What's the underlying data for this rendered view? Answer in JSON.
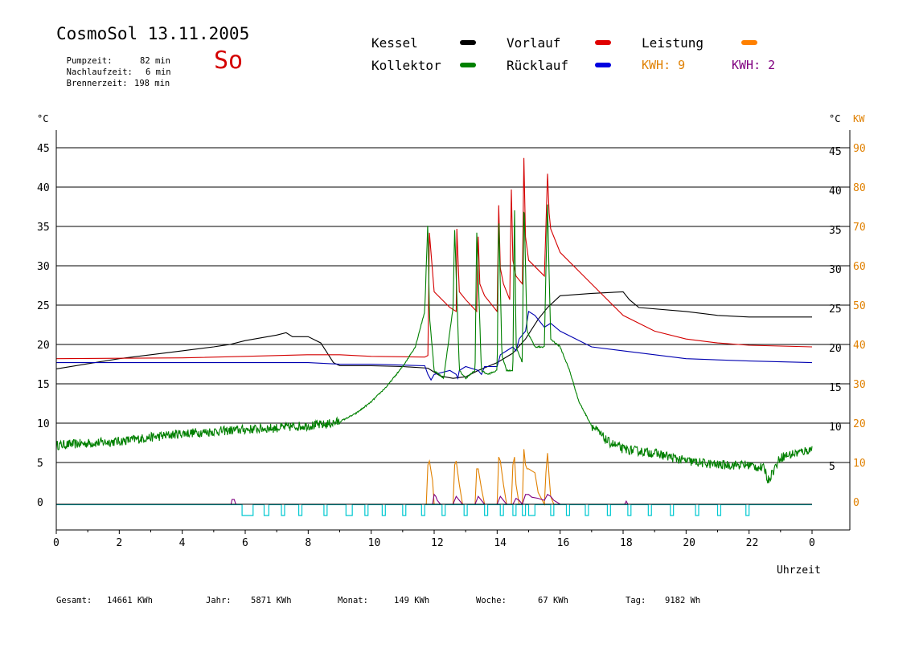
{
  "header": {
    "title": "CosmoSol 13.11.2005",
    "day": "So",
    "stats": [
      {
        "label": "Pumpzeit:",
        "value": "82 min"
      },
      {
        "label": "Nachlaufzeit:",
        "value": "6 min"
      },
      {
        "label": "Brennerzeit:",
        "value": "198 min"
      }
    ]
  },
  "legend": {
    "items": [
      {
        "label": "Kessel",
        "color": "#000000"
      },
      {
        "label": "Vorlauf",
        "color": "#e00000"
      },
      {
        "label": "Leistung",
        "color": "#ff8000"
      },
      {
        "label": "Kollektor",
        "color": "#008000"
      },
      {
        "label": "Rücklauf",
        "color": "#0000e0"
      }
    ],
    "kwh_orange": "KWH: 9",
    "kwh_purple": "KWH: 2"
  },
  "colors": {
    "kessel": "#000000",
    "vorlauf": "#d40000",
    "ruecklauf": "#0000b0",
    "kollektor": "#008000",
    "leistung": "#e08000",
    "purple": "#800080",
    "pump": "#00c8d0"
  },
  "footer": {
    "items": [
      {
        "label": "Gesamt:",
        "value": "14661 KWh"
      },
      {
        "label": "Jahr:",
        "value": "5871 KWh"
      },
      {
        "label": "Monat:",
        "value": "149 KWh"
      },
      {
        "label": "Woche:",
        "value": "67 KWh"
      },
      {
        "label": "Tag:",
        "value": "9182 Wh"
      }
    ]
  },
  "chart_data": {
    "type": "line",
    "xlabel": "Uhrzeit",
    "ylabel_left": "°C",
    "ylabel_right_c": "°C",
    "ylabel_right_kw": "KW",
    "xlim": [
      0,
      24
    ],
    "ylim": [
      0,
      45
    ],
    "kw_lim": [
      0,
      90
    ],
    "x_ticks": [
      0,
      2,
      4,
      6,
      8,
      10,
      12,
      14,
      16,
      18,
      20,
      22,
      24
    ],
    "x_tick_labels": [
      "0",
      "2",
      "4",
      "6",
      "8",
      "10",
      "12",
      "14",
      "16",
      "18",
      "20",
      "22",
      "0"
    ],
    "y_ticks": [
      0,
      5,
      10,
      15,
      20,
      25,
      30,
      35,
      40,
      45
    ],
    "y_tick_labels": [
      "0",
      "5",
      "10",
      "15",
      "20",
      "25",
      "30",
      "35",
      "40",
      "45"
    ],
    "kw_ticks": [
      0,
      10,
      20,
      30,
      40,
      50,
      60,
      70,
      80,
      90
    ],
    "kw_tick_labels": [
      "0",
      "10",
      "20",
      "30",
      "40",
      "50",
      "60",
      "70",
      "80",
      "90"
    ],
    "grid": "horizontal",
    "series": [
      {
        "name": "Kessel",
        "color": "#000000",
        "noise": 0,
        "x": [
          0,
          2,
          4,
          5,
          5.5,
          6,
          7,
          7.3,
          7.5,
          8,
          8.4,
          8.8,
          9,
          10,
          11,
          11.8,
          12.2,
          12.6,
          13,
          13.4,
          14,
          14.5,
          14.9,
          15.3,
          15.6,
          16,
          17,
          18,
          18.2,
          18.5,
          20,
          21,
          22,
          24
        ],
        "y": [
          17.2,
          18.5,
          19.5,
          20,
          20.3,
          20.8,
          21.5,
          21.8,
          21.3,
          21.3,
          20.5,
          18,
          17.6,
          17.6,
          17.5,
          17.3,
          16.3,
          16.0,
          16.2,
          17.0,
          18.0,
          19.2,
          21.0,
          23.5,
          25.0,
          26.5,
          26.8,
          27.0,
          26.0,
          25.0,
          24.5,
          24.0,
          23.8,
          23.8
        ]
      },
      {
        "name": "Vorlauf",
        "color": "#d40000",
        "noise": 0,
        "x": [
          0,
          4,
          6,
          8,
          9,
          10,
          11.7,
          11.8,
          11.85,
          12.0,
          12.5,
          12.7,
          12.72,
          12.8,
          13.0,
          13.35,
          13.4,
          13.45,
          13.6,
          14.0,
          14.05,
          14.1,
          14.2,
          14.4,
          14.45,
          14.5,
          14.6,
          14.8,
          14.85,
          14.9,
          15.0,
          15.5,
          15.6,
          15.65,
          15.7,
          16,
          17,
          18,
          19,
          20,
          21,
          22,
          23,
          24
        ],
        "y": [
          18.5,
          18.6,
          18.8,
          19,
          19,
          18.8,
          18.7,
          18.9,
          34.5,
          27,
          25,
          24.5,
          35,
          27,
          26,
          24.5,
          34,
          28,
          26.5,
          24.5,
          38,
          30,
          28,
          26,
          40,
          31,
          29,
          28,
          44,
          34,
          31,
          29,
          42,
          37,
          35,
          32,
          28,
          24,
          22,
          21,
          20.5,
          20.2,
          20.1,
          20
        ]
      },
      {
        "name": "Rücklauf",
        "color": "#0000b0",
        "noise": 0,
        "x": [
          0,
          4,
          6,
          8,
          9,
          10,
          11.7,
          11.8,
          11.9,
          12.0,
          12.5,
          12.7,
          12.75,
          12.8,
          13.0,
          13.4,
          13.5,
          13.6,
          14.0,
          14.1,
          14.3,
          14.5,
          14.6,
          14.7,
          14.9,
          15.0,
          15.2,
          15.5,
          15.7,
          16,
          17,
          18,
          19,
          20,
          22,
          24
        ],
        "y": [
          18,
          18,
          18,
          18,
          17.8,
          17.8,
          17.6,
          16.5,
          15.8,
          16.5,
          17,
          16.5,
          16,
          17,
          17.5,
          17,
          16.5,
          17.5,
          17.5,
          19,
          19.5,
          20,
          19.5,
          21,
          22,
          24.5,
          24,
          22.5,
          23,
          22,
          20,
          19.5,
          19,
          18.5,
          18.2,
          18
        ]
      },
      {
        "name": "Kollektor",
        "color": "#008000",
        "noise": 0.6,
        "x": [
          0,
          2,
          4,
          6,
          7,
          8,
          8.5,
          9,
          9.5,
          10,
          10.5,
          11,
          11.4,
          11.7,
          11.8,
          11.85,
          12.0,
          12.3,
          12.5,
          12.6,
          12.65,
          12.8,
          13.0,
          13.3,
          13.35,
          13.5,
          13.7,
          14.0,
          14.05,
          14.15,
          14.3,
          14.5,
          14.55,
          14.6,
          14.8,
          14.85,
          14.95,
          15.2,
          15.5,
          15.55,
          15.6,
          15.7,
          16,
          16.3,
          16.6,
          17,
          17.5,
          18,
          19,
          20,
          21,
          22,
          22.5,
          22.6,
          23,
          23.5,
          24
        ],
        "y": [
          7.5,
          8,
          9,
          9.5,
          9.7,
          10,
          10.1,
          10.5,
          11.5,
          13,
          15,
          17.5,
          20,
          24.5,
          36,
          24,
          17,
          16,
          22,
          25,
          35,
          17,
          16,
          17,
          35,
          17,
          16.5,
          17,
          37,
          19,
          17,
          17,
          39,
          20,
          18,
          39,
          22,
          20,
          20,
          30,
          38,
          21,
          20,
          17,
          13,
          10,
          8,
          7,
          6.5,
          5.5,
          5,
          5,
          4.5,
          3,
          6,
          6.5,
          7
        ]
      },
      {
        "name": "Leistung",
        "color": "#e08000",
        "noise": 0,
        "axis": "kw",
        "x": [
          0,
          11.75,
          11.8,
          11.85,
          11.95,
          12.0,
          12.6,
          12.65,
          12.7,
          12.8,
          12.9,
          13.3,
          13.35,
          13.4,
          13.5,
          13.6,
          14.0,
          14.05,
          14.1,
          14.2,
          14.3,
          14.45,
          14.5,
          14.55,
          14.6,
          14.7,
          14.8,
          14.85,
          14.9,
          14.95,
          15.0,
          15.2,
          15.3,
          15.5,
          15.55,
          15.6,
          15.65,
          15.7,
          15.8,
          16.0,
          24
        ],
        "y": [
          0,
          0,
          10,
          11,
          6,
          0,
          0,
          10,
          11,
          5,
          0,
          0,
          9,
          9,
          4,
          0,
          0,
          12,
          11,
          5,
          0,
          0,
          10,
          12,
          5,
          0,
          0,
          14,
          10,
          9,
          9,
          8,
          3,
          0,
          8,
          13,
          7,
          2,
          0,
          0,
          0
        ]
      },
      {
        "name": "",
        "color": "#800080",
        "noise": 0,
        "axis": "kw",
        "x": [
          0,
          5.55,
          5.58,
          5.6,
          5.65,
          5.7,
          11.95,
          12.0,
          12.05,
          12.1,
          12.2,
          12.6,
          12.7,
          12.8,
          12.9,
          13.3,
          13.4,
          13.5,
          13.6,
          14.0,
          14.1,
          14.2,
          14.3,
          14.5,
          14.6,
          14.7,
          14.8,
          14.9,
          15.0,
          15.1,
          15.3,
          15.5,
          15.6,
          15.7,
          15.8,
          15.9,
          16.0,
          18.05,
          18.1,
          18.15,
          24
        ],
        "y": [
          0,
          0,
          1.2,
          1.2,
          1.2,
          0,
          0,
          2.5,
          2,
          1,
          0,
          0,
          2,
          1,
          0,
          0,
          2,
          1,
          0,
          0,
          2,
          1,
          0,
          0,
          1.5,
          1,
          0,
          2.5,
          2.5,
          1.8,
          1.5,
          1,
          2.5,
          2,
          1,
          0.5,
          0,
          0,
          0.8,
          0,
          0
        ]
      }
    ],
    "pump_pulses": [
      [
        5.9,
        6.25
      ],
      [
        6.6,
        6.75
      ],
      [
        7.15,
        7.25
      ],
      [
        7.7,
        7.8
      ],
      [
        8.5,
        8.6
      ],
      [
        9.2,
        9.4
      ],
      [
        9.8,
        9.9
      ],
      [
        10.35,
        10.45
      ],
      [
        11.0,
        11.1
      ],
      [
        11.6,
        11.7
      ],
      [
        12.25,
        12.35
      ],
      [
        12.95,
        13.05
      ],
      [
        13.6,
        13.7
      ],
      [
        14.1,
        14.2
      ],
      [
        14.5,
        14.6
      ],
      [
        14.8,
        14.9
      ],
      [
        15.0,
        15.2
      ],
      [
        15.7,
        15.8
      ],
      [
        16.2,
        16.3
      ],
      [
        16.8,
        16.9
      ],
      [
        17.5,
        17.6
      ],
      [
        18.15,
        18.25
      ],
      [
        18.8,
        18.9
      ],
      [
        19.5,
        19.6
      ],
      [
        20.3,
        20.4
      ],
      [
        21.0,
        21.1
      ],
      [
        21.9,
        22.0
      ]
    ]
  }
}
